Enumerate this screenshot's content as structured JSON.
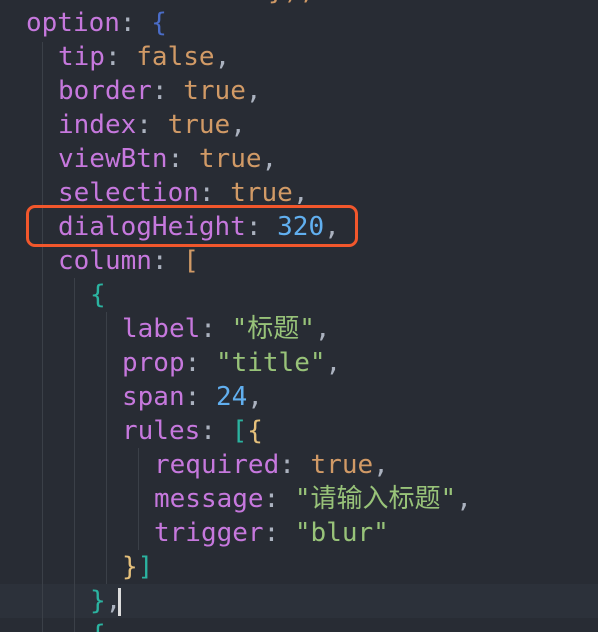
{
  "code": {
    "top_fragment": "});",
    "line_option_key": "option",
    "line_option_open": "{",
    "tip_key": "tip",
    "tip_val": "false",
    "border_key": "border",
    "border_val": "true",
    "index_key": "index",
    "index_val": "true",
    "viewBtn_key": "viewBtn",
    "viewBtn_val": "true",
    "selection_key": "selection",
    "selection_val": "true",
    "dialogHeight_key": "dialogHeight",
    "dialogHeight_val": "320",
    "column_key": "column",
    "column_open": "[",
    "obj_open": "{",
    "label_key": "label",
    "label_val": "\"标题\"",
    "prop_key": "prop",
    "prop_val": "\"title\"",
    "span_key": "span",
    "span_val": "24",
    "rules_key": "rules",
    "rules_open_bracket": "[",
    "rules_open_brace": "{",
    "required_key": "required",
    "required_val": "true",
    "message_key": "message",
    "message_val": "\"请输入标题\"",
    "trigger_key": "trigger",
    "trigger_val": "\"blur\"",
    "rules_close_brace": "}",
    "rules_close_bracket": "]",
    "obj_close": "}",
    "next_obj_open": "{"
  },
  "colors": {
    "background": "#282c34",
    "key": "#c678dd",
    "boolean": "#d19a66",
    "number": "#61afef",
    "string": "#98c379",
    "highlight_border": "#f2572c"
  }
}
